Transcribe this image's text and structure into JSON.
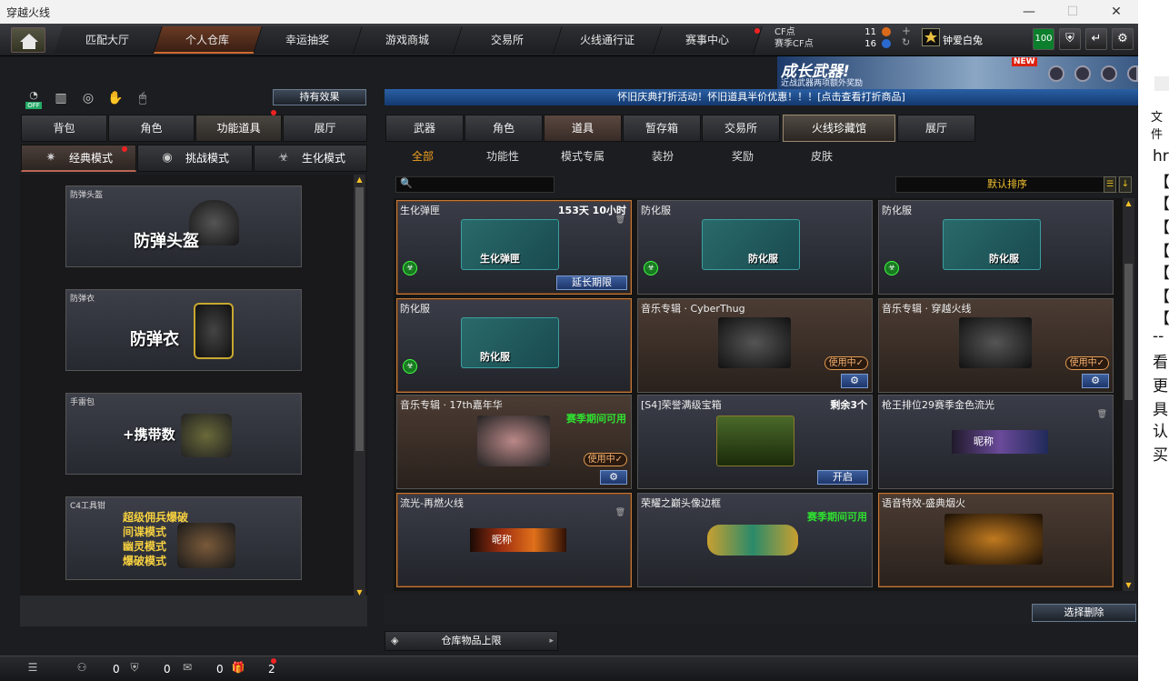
{
  "window": {
    "title": "穿越火线"
  },
  "nav": {
    "items": [
      {
        "label": "匹配大厅"
      },
      {
        "label": "个人仓库"
      },
      {
        "label": "幸运抽奖"
      },
      {
        "label": "游戏商城"
      },
      {
        "label": "交易所"
      },
      {
        "label": "火线通行证"
      },
      {
        "label": "赛事中心"
      }
    ],
    "active": "个人仓库"
  },
  "currency": {
    "cf_label": "CF点",
    "season_label": "赛季CF点",
    "cf_value": "11",
    "season_value": "16"
  },
  "user": {
    "name": "钟爱白兔",
    "level": "100"
  },
  "banner": {
    "title": "成长武器!",
    "subtitle": "近战武器两项额外奖励",
    "new_tag": "NEW"
  },
  "left": {
    "effect_button": "持有效果",
    "toolbar_icons": [
      "off-toggle-icon",
      "ranking-icon",
      "refresh-icon",
      "hand-icon",
      "mouse-icon"
    ],
    "off_label": "OFF",
    "tabs": [
      {
        "label": "背包"
      },
      {
        "label": "角色"
      },
      {
        "label": "功能道具"
      },
      {
        "label": "展厅"
      }
    ],
    "modes": [
      {
        "label": "经典模式"
      },
      {
        "label": "挑战模式"
      },
      {
        "label": "生化模式"
      }
    ],
    "cards": [
      {
        "category": "防弹头盔",
        "label": "防弹头盔"
      },
      {
        "category": "防弹衣",
        "label": "防弹衣"
      },
      {
        "category": "手雷包",
        "label": "+携带数"
      },
      {
        "category": "C4工具钳",
        "lines": [
          "超级佣兵爆破",
          "间谍模式",
          "幽灵模式",
          "爆破模式"
        ]
      }
    ]
  },
  "right": {
    "marquee": "怀旧庆典打折活动！怀旧道具半价优惠！！！[点击查看打折商品]",
    "tabs": [
      {
        "label": "武器"
      },
      {
        "label": "角色"
      },
      {
        "label": "道具"
      },
      {
        "label": "暂存箱"
      },
      {
        "label": "交易所"
      },
      {
        "label": "火线珍藏馆"
      },
      {
        "label": "展厅"
      }
    ],
    "subtabs": [
      {
        "label": "全部"
      },
      {
        "label": "功能性"
      },
      {
        "label": "模式专属"
      },
      {
        "label": "装扮"
      },
      {
        "label": "奖励"
      },
      {
        "label": "皮肤"
      }
    ],
    "search_placeholder": "",
    "sort": "默认排序",
    "items": [
      {
        "name": "生化弹匣",
        "info": "153天 10小时",
        "img_label": "生化弹匣",
        "action": "延长期限"
      },
      {
        "name": "防化服",
        "img_label": "防化服"
      },
      {
        "name": "防化服",
        "img_label": "防化服"
      },
      {
        "name": "防化服",
        "img_label": "防化服"
      },
      {
        "name": "音乐专辑 · CyberThug",
        "status": "使用中✓"
      },
      {
        "name": "音乐专辑 · 穿越火线",
        "status": "使用中✓"
      },
      {
        "name": "音乐专辑 · 17th嘉年华",
        "info": "赛季期间可用",
        "status": "使用中✓"
      },
      {
        "name": "[S4]荣誉满级宝箱",
        "info": "剩余3个",
        "action": "开启"
      },
      {
        "name": "枪王排位29赛季金色流光",
        "nick": "昵称"
      },
      {
        "name": "流光-再燃火线",
        "nick": "昵称"
      },
      {
        "name": "荣耀之巅头像边框",
        "info": "赛季期间可用"
      },
      {
        "name": "语音特效-盛典烟火"
      }
    ],
    "select_delete": "选择删除",
    "store_limit": "仓库物品上限"
  },
  "status": {
    "val1": "0",
    "val2": "0",
    "val3": "0",
    "val4": "2"
  },
  "side": {
    "chars": [
      "文件",
      "hr",
      "【",
      "【",
      "【",
      "【",
      "【",
      "【",
      "【",
      "--",
      "看",
      "更",
      "具",
      "认",
      "买"
    ]
  }
}
